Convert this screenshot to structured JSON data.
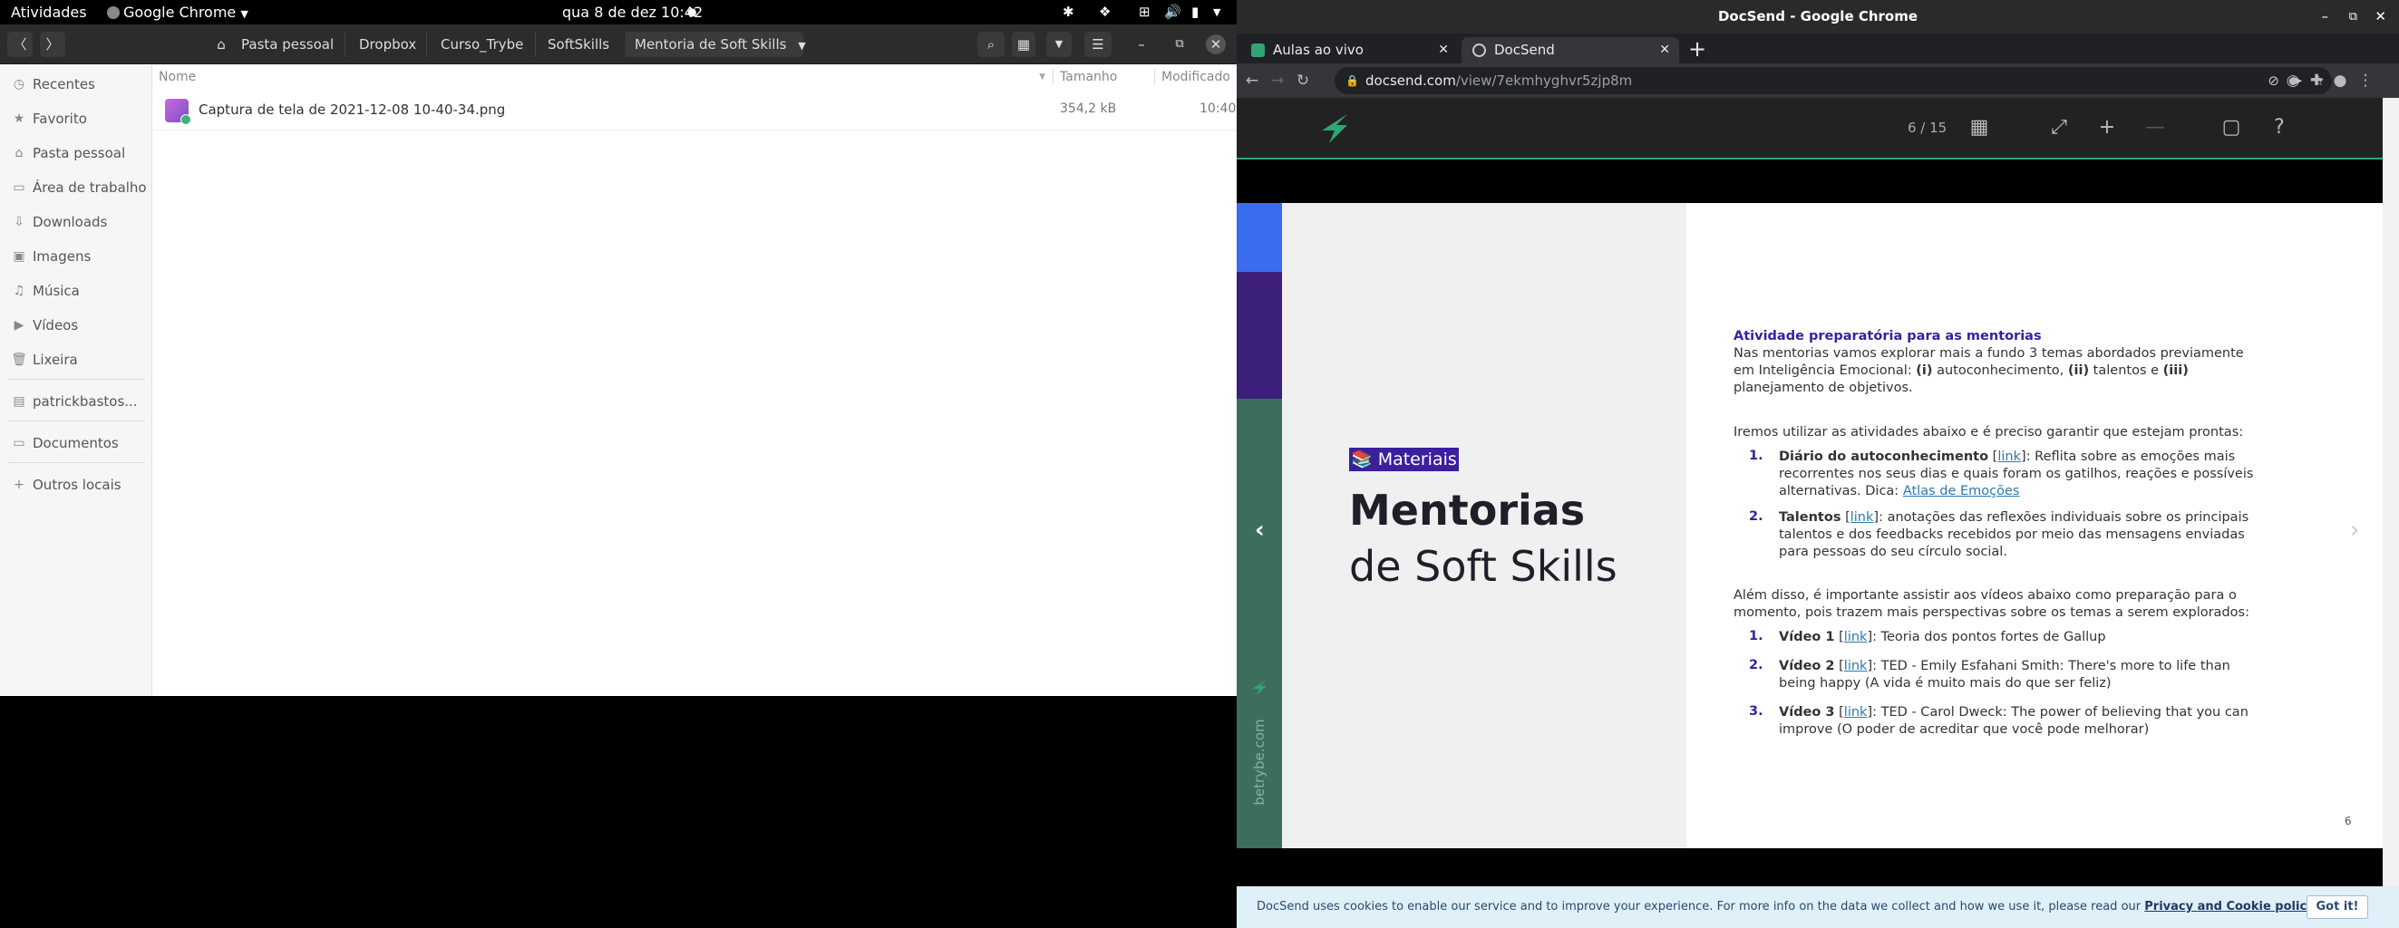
{
  "topbar": {
    "activities": "Atividades",
    "app_name": "Google Chrome",
    "clock": "qua 8 de dez  10:42"
  },
  "files": {
    "breadcrumbs": [
      "Pasta pessoal",
      "Dropbox",
      "Curso_Trybe",
      "SoftSkills",
      "Mentoria de Soft Skills"
    ],
    "sidebar": [
      "Recentes",
      "Favorito",
      "Pasta pessoal",
      "Área de trabalho",
      "Downloads",
      "Imagens",
      "Música",
      "Vídeos",
      "Lixeira",
      "patrickbastos...",
      "Documentos",
      "Outros locais"
    ],
    "columns": {
      "name": "Nome",
      "size": "Tamanho",
      "modified": "Modificado"
    },
    "rows": [
      {
        "name": "Captura de tela de 2021-12-08 10-40-34.png",
        "size": "354,2 kB",
        "modified": "10:40"
      }
    ]
  },
  "browser": {
    "window_title": "DocSend - Google Chrome",
    "tabs": [
      {
        "label": "Aulas ao vivo"
      },
      {
        "label": "DocSend"
      }
    ],
    "url_host": "docsend.com",
    "url_path": "/view/7ekmhyghvr5zjp8m"
  },
  "docsend": {
    "page_counter": "6 / 15",
    "cookie_text": "DocSend uses cookies to enable our service and to improve your experience. For more info on the data we collect and how we use it, please read our",
    "cookie_link": "Privacy and Cookie policies.",
    "cookie_button": "Got it!"
  },
  "slide": {
    "tag": "📚 Materiais",
    "title1": "Mentorias",
    "title2": "de Soft Skills",
    "side_logo_text": "betrybe.com",
    "page_number": "6",
    "heading": "Atividade preparatória para as mentorias",
    "p1_a": "Nas mentorias vamos explorar mais a fundo 3 temas abordados previamente",
    "p1_b1": "em Inteligência Emocional: ",
    "p1_b_i": "(i)",
    "p1_b2": " autoconhecimento, ",
    "p1_b_ii": "(ii)",
    "p1_b3": " talentos e ",
    "p1_b_iii": "(iii)",
    "p1_c": "planejamento de objetivos.",
    "p2": "Iremos utilizar as atividades abaixo e é preciso garantir que estejam prontas:",
    "link": "link",
    "item1_title": "Diário do autoconhecimento",
    "item1_l1": ": Reflita sobre as emoções mais",
    "item1_l2": "recorrentes nos seus dias e quais foram os gatilhos, reações e possíveis",
    "item1_l3": "alternativas. Dica: ",
    "item1_link2": "Atlas de Emoções",
    "item2_title": "Talentos",
    "item2_l1": ": anotações das reflexões individuais sobre os principais",
    "item2_l2": "talentos e dos feedbacks recebidos por meio das mensagens enviadas",
    "item2_l3": "para pessoas do seu círculo social.",
    "p3_a": "Além disso, é importante assistir aos vídeos abaixo como preparação para o",
    "p3_b": "momento, pois trazem mais perspectivas sobre os temas a serem explorados:",
    "v1_title": "Vídeo 1",
    "v1_text": ": Teoria dos pontos fortes de Gallup",
    "v2_title": "Vídeo 2",
    "v2_l1": ": TED - Emily Esfahani Smith: There's more to life than",
    "v2_l2": "being happy (A vida é muito mais do que ser feliz)",
    "v3_title": "Vídeo 3",
    "v3_l1": ": TED - Carol Dweck: The power of believing that you can",
    "v3_l2": "improve (O poder de acreditar que você pode melhorar)",
    "n1": "1.",
    "n2": "2.",
    "n3": "3."
  }
}
